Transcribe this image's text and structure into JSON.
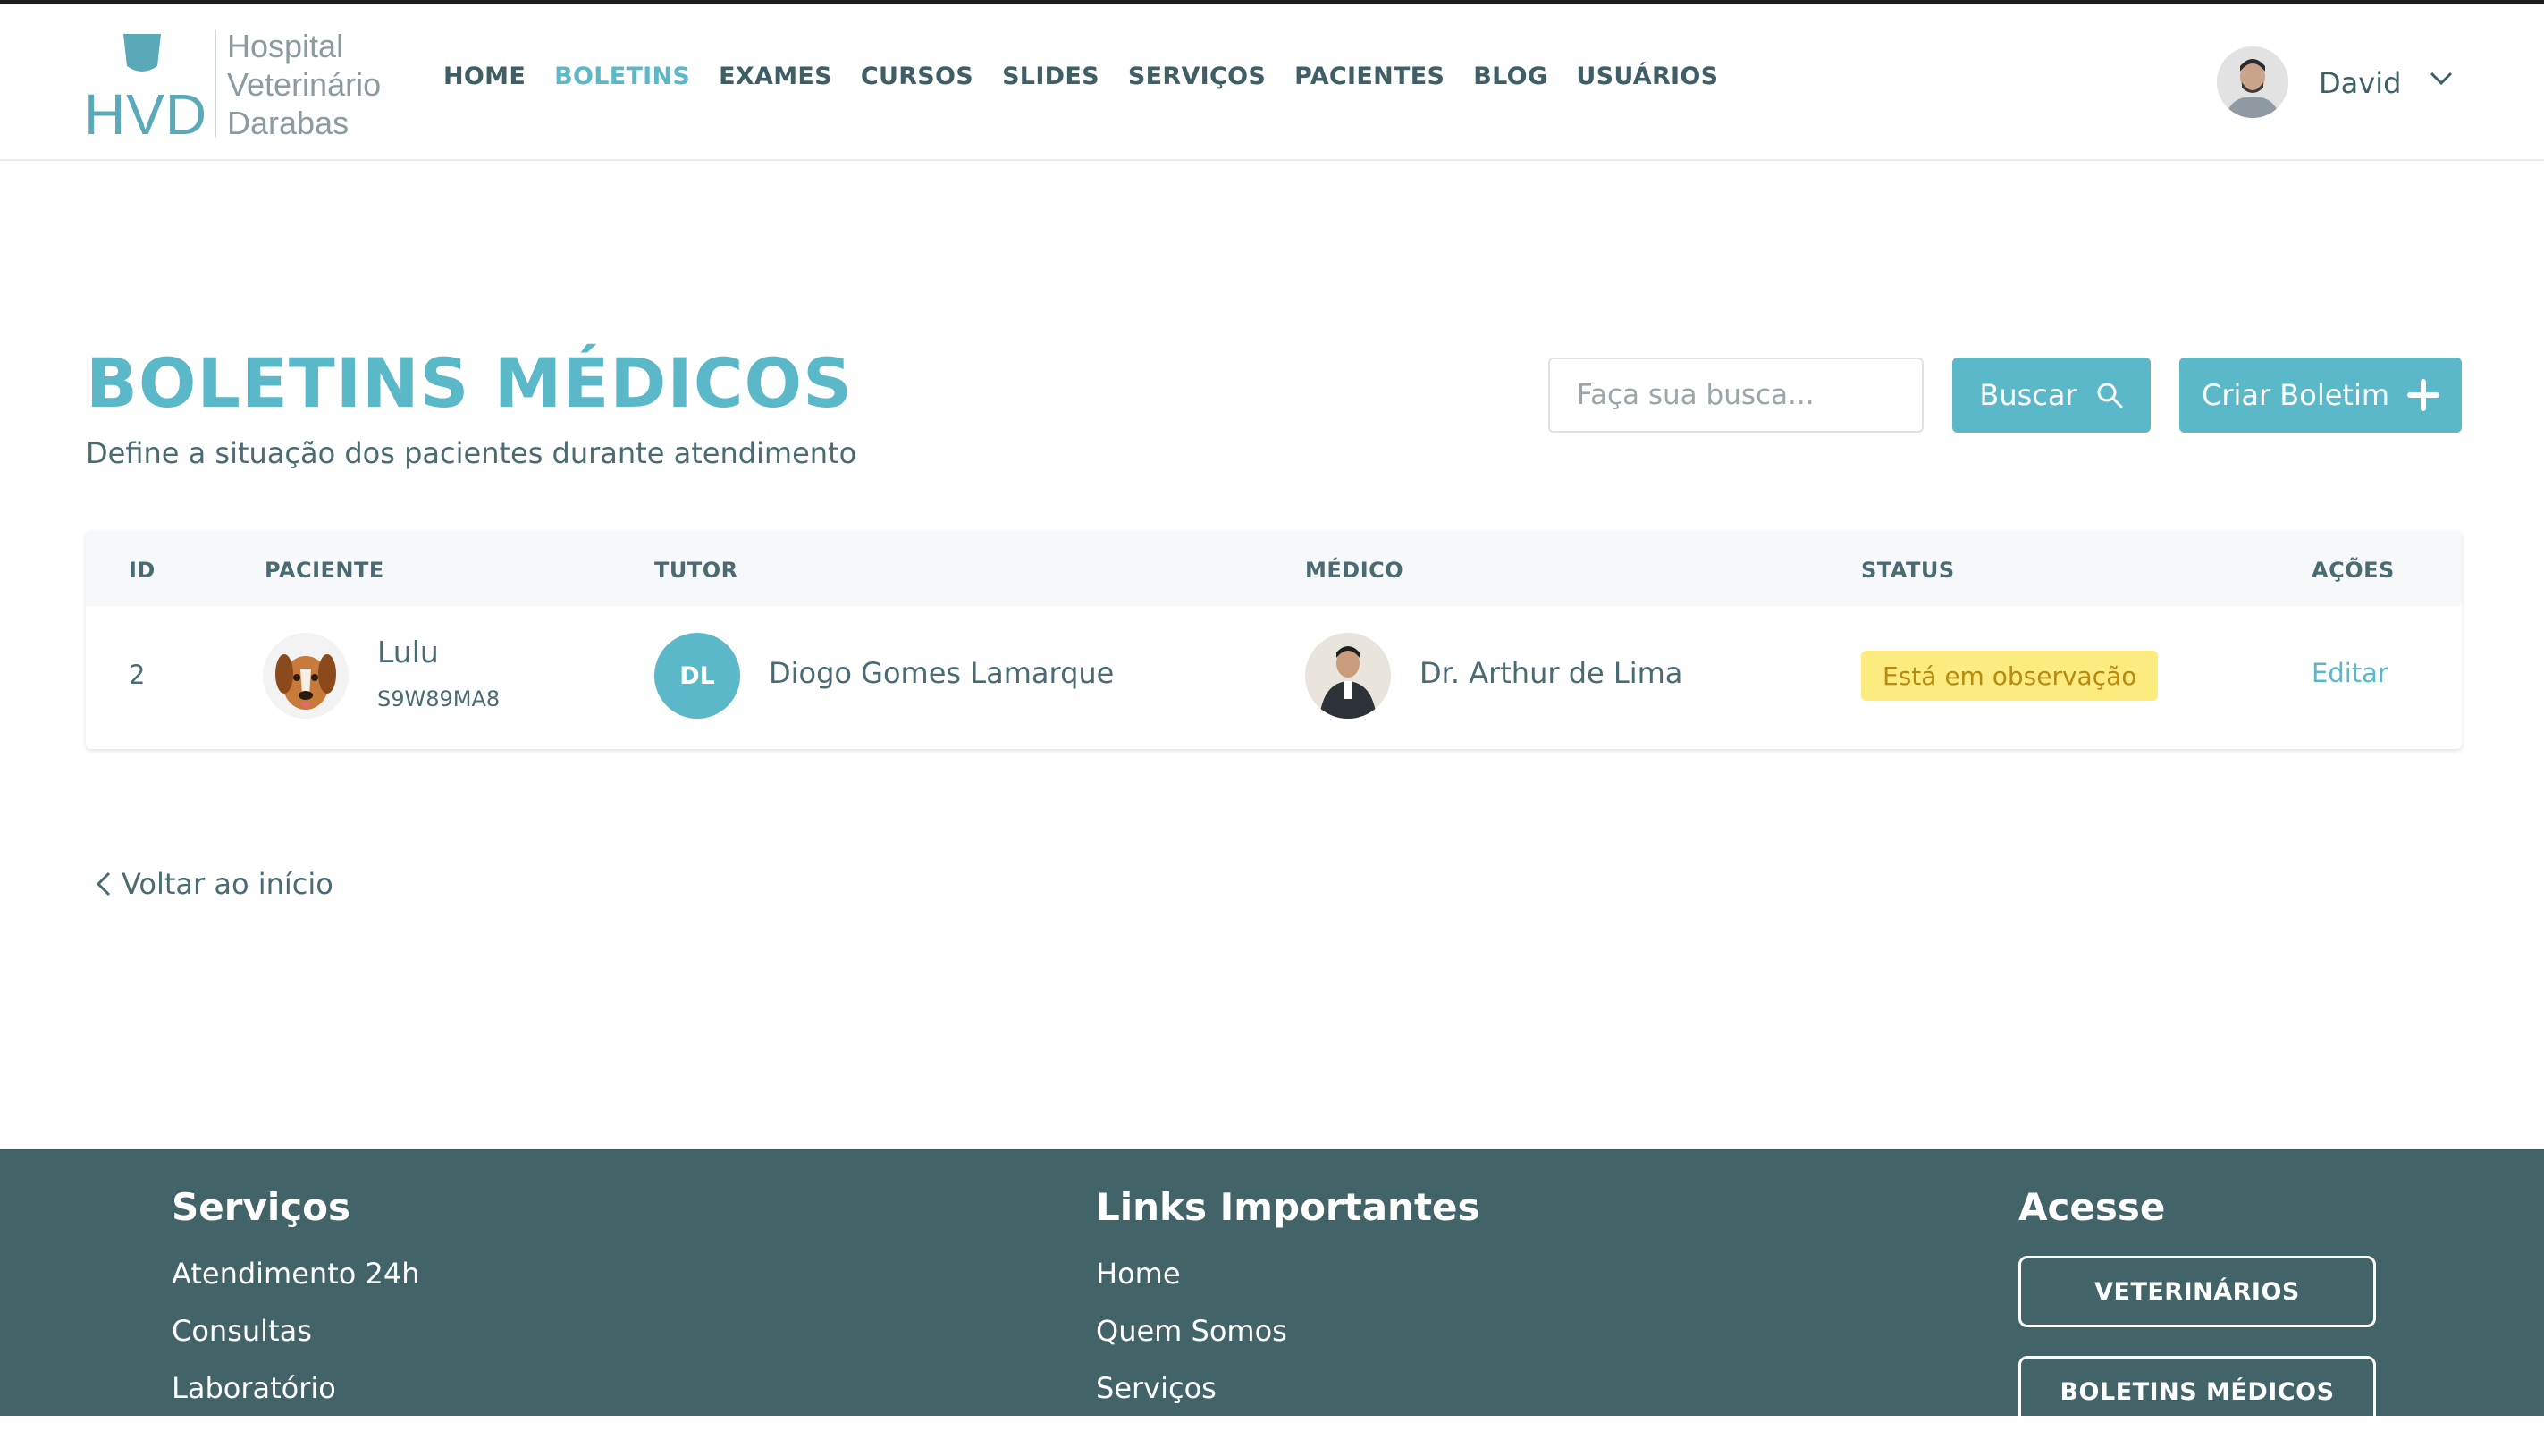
{
  "logo": {
    "mark": "HVD",
    "lines": [
      "Hospital",
      "Veterinário",
      "Darabas"
    ]
  },
  "nav": {
    "items": [
      "HOME",
      "BOLETINS",
      "EXAMES",
      "CURSOS",
      "SLIDES",
      "SERVIÇOS",
      "PACIENTES",
      "BLOG",
      "USUÁRIOS"
    ],
    "active": "BOLETINS"
  },
  "user": {
    "name": "David"
  },
  "page": {
    "title": "BOLETINS MÉDICOS",
    "subtitle": "Define a situação dos pacientes durante atendimento"
  },
  "search": {
    "placeholder": "Faça sua busca...",
    "button": "Buscar"
  },
  "create_button": "Criar Boletim",
  "table": {
    "headers": [
      "ID",
      "PACIENTE",
      "TUTOR",
      "MÉDICO",
      "STATUS",
      "AÇÕES"
    ],
    "rows": [
      {
        "id": "2",
        "patient_name": "Lulu",
        "patient_code": "S9W89MA8",
        "tutor_initials": "DL",
        "tutor_name": "Diogo Gomes Lamarque",
        "doctor_name": "Dr. Arthur de Lima",
        "status": "Está em observação",
        "action": "Editar"
      }
    ]
  },
  "back_link": "Voltar ao início",
  "footer": {
    "services": {
      "title": "Serviços",
      "links": [
        "Atendimento 24h",
        "Consultas",
        "Laboratório"
      ]
    },
    "links": {
      "title": "Links Importantes",
      "links": [
        "Home",
        "Quem Somos",
        "Serviços"
      ]
    },
    "access": {
      "title": "Acesse",
      "buttons": [
        "VETERINÁRIOS",
        "BOLETINS MÉDICOS"
      ]
    }
  },
  "colors": {
    "accent": "#5ab8c9",
    "footer_bg": "#426468",
    "badge_bg": "#fcec7f",
    "badge_text": "#b98a10",
    "text": "#4a6b72"
  }
}
